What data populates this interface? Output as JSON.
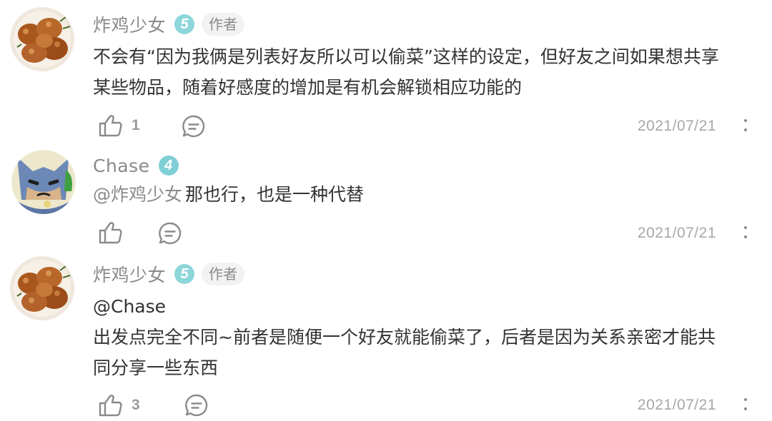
{
  "comments": [
    {
      "username": "炸鸡少女",
      "level": "5",
      "level_color": "#8dd6da",
      "tag": "作者",
      "lines": [
        "不会有“因为我俩是列表好友所以可以偷菜”这样的设定，但好友之间如果想共享",
        "某些物品，随着好感度的增加是有机会解锁相应功能的"
      ],
      "likes": "1",
      "date": "2021/07/21",
      "avatar_icon": "fried-chicken"
    },
    {
      "username": "Chase",
      "level": "4",
      "level_color": "#7fcfd6",
      "mention": "@炸鸡少女",
      "lines": [
        "那也行，也是一种代替"
      ],
      "likes": "",
      "date": "2021/07/21",
      "avatar_icon": "batman-cartoon"
    },
    {
      "username": "炸鸡少女",
      "level": "5",
      "level_color": "#8dd6da",
      "tag": "作者",
      "mention": "@Chase",
      "lines": [
        "出发点完全不同~前者是随便一个好友就能偷菜了，后者是因为关系亲密才能共",
        "同分享一些东西"
      ],
      "likes": "3",
      "date": "2021/07/21",
      "avatar_icon": "fried-chicken"
    }
  ]
}
